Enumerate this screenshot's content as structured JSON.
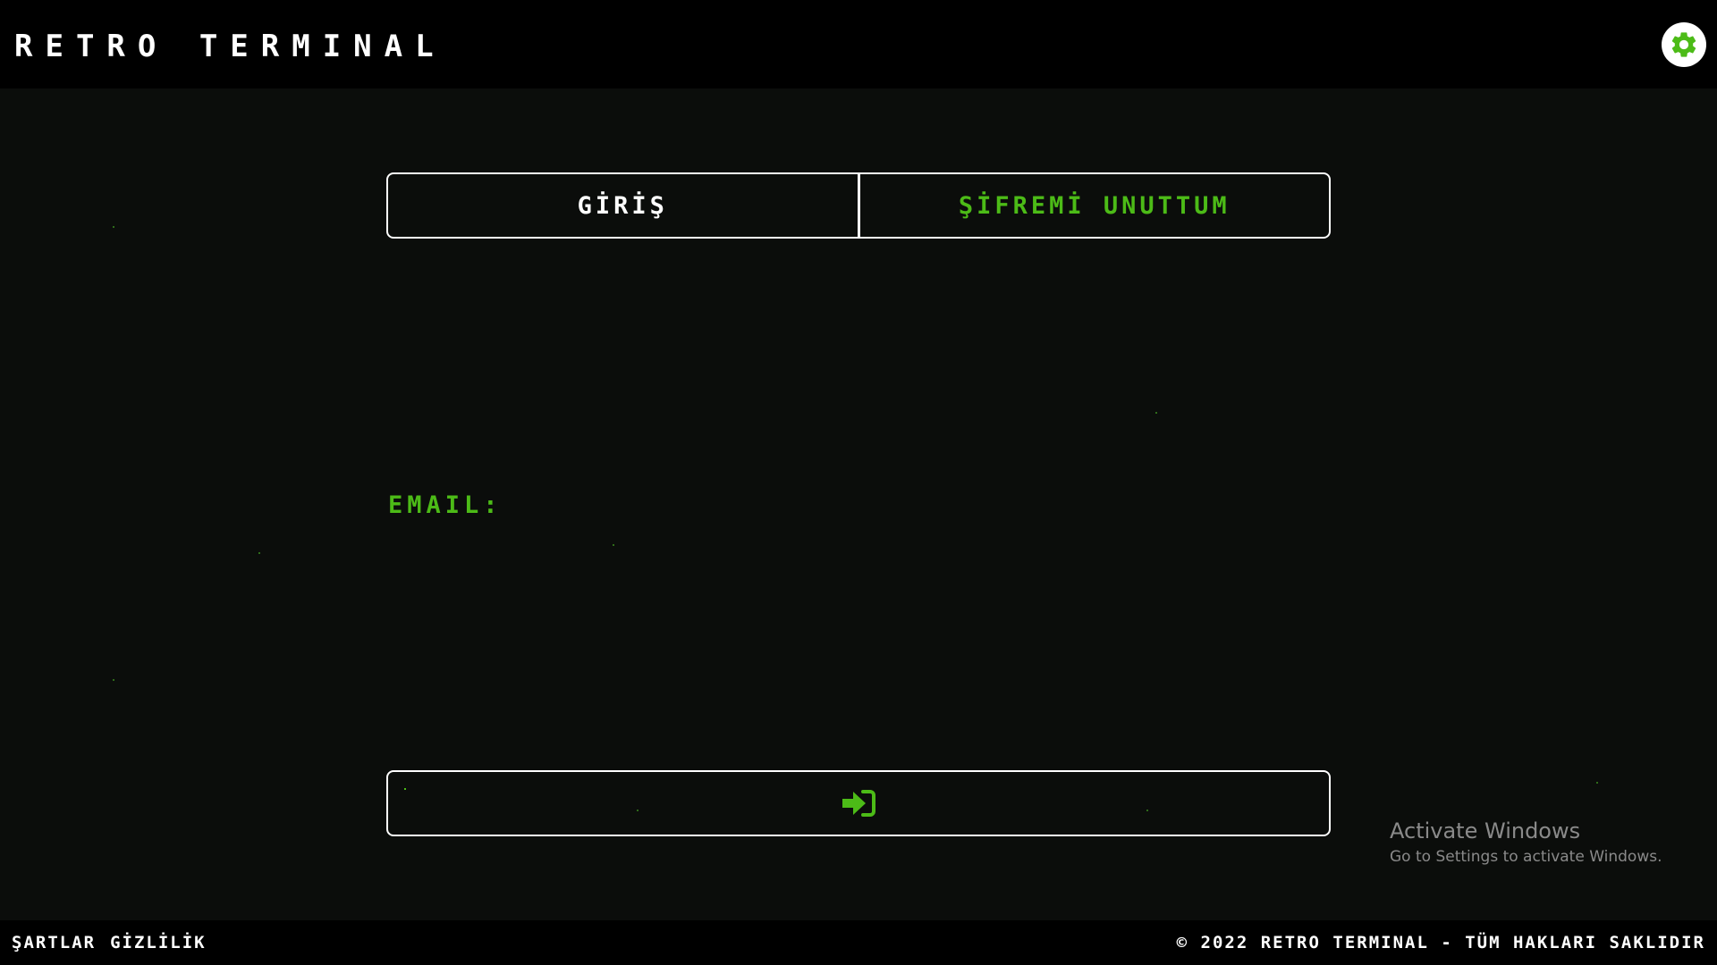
{
  "header": {
    "title": "RETRO TERMINAL",
    "settings_icon": "gear-icon"
  },
  "tabs": [
    {
      "label": "GİRİŞ",
      "active": true
    },
    {
      "label": "ŞİFREMİ UNUTTUM",
      "active": false
    }
  ],
  "form": {
    "email_label": "EMAIL:",
    "email_value": "",
    "submit_icon": "sign-in-arrow-icon"
  },
  "footer": {
    "links": [
      "ŞARTLAR",
      "GİZLİLİK"
    ],
    "copyright": "© 2022 RETRO TERMINAL - TÜM HAKLARI SAKLIDIR"
  },
  "watermark": {
    "title": "Activate Windows",
    "subtitle": "Go to Settings to activate Windows."
  },
  "colors": {
    "accent": "#4cbb17",
    "background": "#0b0d0b",
    "bar": "#000000",
    "border": "#ffffff"
  }
}
